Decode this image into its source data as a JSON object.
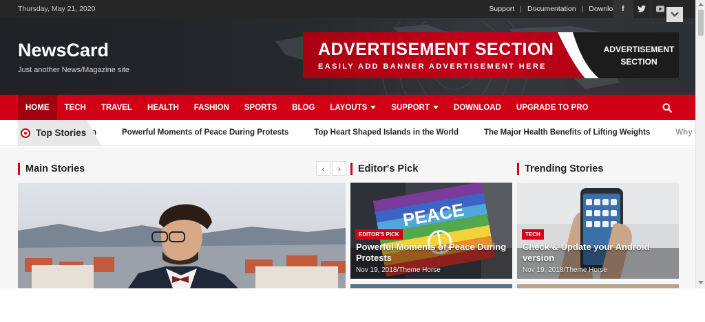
{
  "topbar": {
    "date": "Thursday, May 21, 2020",
    "links": [
      "Support",
      "Documentation",
      "Download"
    ],
    "separator": "|",
    "social": [
      "facebook-icon",
      "twitter-icon",
      "youtube-icon"
    ]
  },
  "header": {
    "site_title": "NewsCard",
    "tagline": "Just another News/Magazine site",
    "ad_title": "ADVERTISEMENT SECTION",
    "ad_subtitle": "EASILY ADD BANNER ADVERTISEMENT HERE",
    "ad_side_line1": "ADVERTISEMENT",
    "ad_side_line2": "SECTION"
  },
  "nav": {
    "items": [
      {
        "label": "HOME",
        "active": true
      },
      {
        "label": "TECH"
      },
      {
        "label": "TRAVEL"
      },
      {
        "label": "HEALTH"
      },
      {
        "label": "FASHION"
      },
      {
        "label": "SPORTS"
      },
      {
        "label": "BLOG"
      },
      {
        "label": "LAYOUTS",
        "dropdown": true
      },
      {
        "label": "SUPPORT",
        "dropdown": true
      },
      {
        "label": "DOWNLOAD"
      },
      {
        "label": "UPGRADE TO PRO"
      }
    ],
    "search_icon": "search-icon"
  },
  "ticker": {
    "label": "Top Stories",
    "fragment": "n",
    "items": [
      "Powerful Moments of Peace During Protests",
      "Top Heart Shaped Islands in the World",
      "The Major Health Benefits of Lifting Weights"
    ],
    "trailing": "Why the"
  },
  "sections": {
    "main": "Main Stories",
    "editors": "Editor's Pick",
    "trending": "Trending Stories"
  },
  "cards": {
    "editors": {
      "badge": "EDITOR'S PICK",
      "title": "Powerful Moments of Peace During Protests",
      "meta": "Nov 19, 2018/Theme Horse",
      "sign_text": "PEACE"
    },
    "trending": {
      "badge": "TECH",
      "title": "Check & Update your Android version",
      "meta": "Nov 19, 2018/Theme Horse"
    }
  },
  "colors": {
    "accent": "#d10014",
    "topbar": "#262626"
  }
}
